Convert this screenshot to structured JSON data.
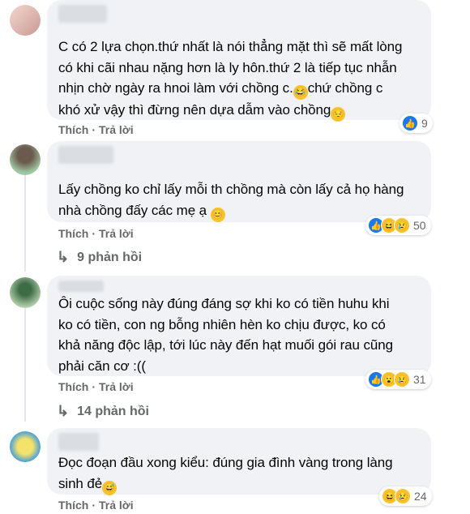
{
  "comments": [
    {
      "text_lines": [
        "C có 2 lựa chọn.thứ nhất là nói thẳng mặt thì sẽ mất lòng",
        "có khi cãi nhau nặng hơn là ly hôn.thứ 2 là tiếp tục nhẫn",
        "nhịn chờ ngày ra hnoi làm với chồng c.",
        "khó xử vậy thì đừng nên dựa dẫm vào chồng"
      ],
      "line3_tail": "chứ chồng c",
      "like_label": "Thích",
      "reply_label": "Trả lời",
      "reaction_count": "9",
      "reactions": [
        "like-icon"
      ]
    },
    {
      "text_lines": [
        "Lấy chồng ko chỉ lấy mỗi th chồng mà còn lấy cả họ hàng",
        "nhà chồng đấy các mẹ ạ"
      ],
      "like_label": "Thích",
      "reply_label": "Trả lời",
      "reaction_count": "50",
      "reactions": [
        "like-icon",
        "haha-icon",
        "sad-icon"
      ],
      "replies_label": "9 phản hồi"
    },
    {
      "text_lines": [
        "Ôi cuộc sống này đúng đáng sợ khi ko có tiền huhu khi",
        "ko có tiền, con ng bỗng nhiên hèn ko chịu được, ko có",
        "khả năng độc lập, tới lúc này đến hạt muối gói rau cũng",
        "phải căn cơ :(("
      ],
      "like_label": "Thích",
      "reply_label": "Trả lời",
      "reaction_count": "31",
      "reactions": [
        "like-icon",
        "wow-icon",
        "sad-icon"
      ],
      "replies_label": "14 phản hồi"
    },
    {
      "text_lines": [
        "Đọc đoạn đầu xong kiểu: đúng gia đình vàng trong làng",
        "sinh đẻ"
      ],
      "like_label": "Thích",
      "reply_label": "Trả lời",
      "reaction_count": "24",
      "reactions": [
        "haha-icon",
        "sad-icon"
      ]
    }
  ],
  "colors": {
    "bubble": "#f0f2f5",
    "meta": "#65676b",
    "like": "#1877f2",
    "emoji": "#f7c22c"
  }
}
